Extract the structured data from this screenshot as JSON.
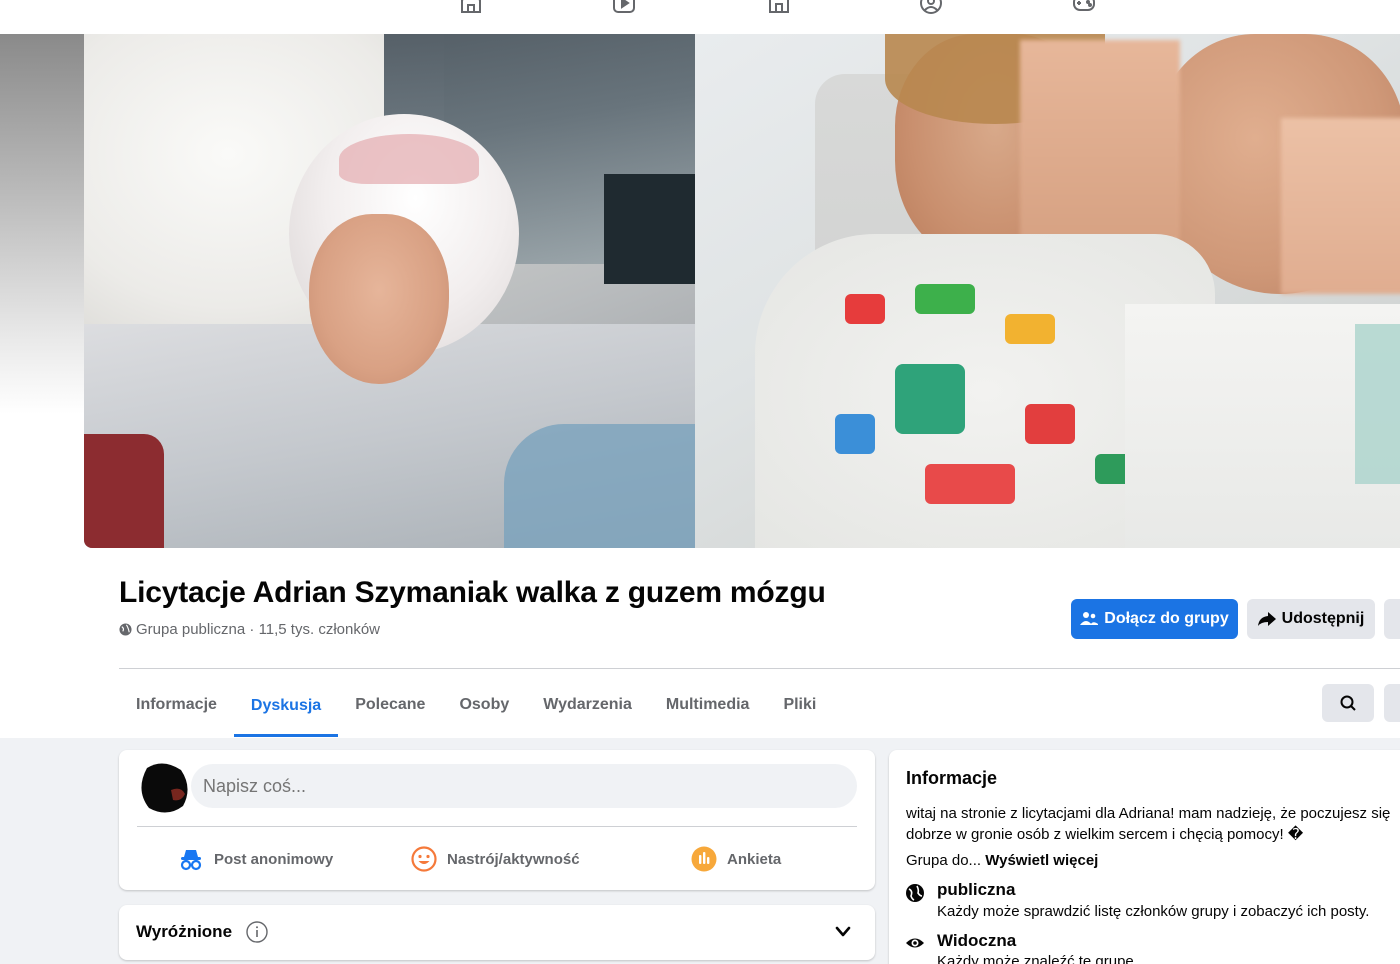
{
  "nav": {
    "icons": [
      "home-icon",
      "video-icon",
      "marketplace-icon",
      "groups-icon",
      "gaming-icon"
    ]
  },
  "group": {
    "title": "Licytacje Adrian Szymaniak walka z guzem mózgu",
    "meta": "Grupa publiczna · 11,5 tys. członków"
  },
  "actions": {
    "join_label": "Dołącz do grupy",
    "share_label": "Udostępnij"
  },
  "tabs": [
    {
      "label": "Informacje"
    },
    {
      "label": "Dyskusja",
      "active": true
    },
    {
      "label": "Polecane"
    },
    {
      "label": "Osoby"
    },
    {
      "label": "Wydarzenia"
    },
    {
      "label": "Multimedia"
    },
    {
      "label": "Pliki"
    }
  ],
  "composer": {
    "placeholder": "Napisz coś...",
    "actions": [
      {
        "label": "Post anonimowy",
        "icon": "anonymous-icon",
        "color": "#1877f2"
      },
      {
        "label": "Nastrój/aktywność",
        "icon": "feeling-icon",
        "color": "#f7b928"
      },
      {
        "label": "Ankieta",
        "icon": "poll-icon",
        "color": "#f5533d"
      }
    ]
  },
  "featured": {
    "title": "Wyróżnione"
  },
  "info": {
    "title": "Informacje",
    "description": "witaj na stronie z licytacjami dla Adriana! mam nadzieję, że poczujesz się dobrze w gronie osób z wielkim sercem i chęcią pomocy! �",
    "more_prefix": "Grupa do... ",
    "more_link": "Wyświetl więcej",
    "rows": [
      {
        "icon": "globe-icon",
        "title": "publiczna",
        "subtitle": "Każdy może sprawdzić listę członków grupy i zobaczyć ich posty."
      },
      {
        "icon": "eye-icon",
        "title": "Widoczna",
        "subtitle": "Każdy może znaleźć tę grupę."
      }
    ]
  },
  "colors": {
    "accent": "#1b74e4",
    "secondary_text": "#65676b",
    "page_bg": "#f0f2f5"
  }
}
